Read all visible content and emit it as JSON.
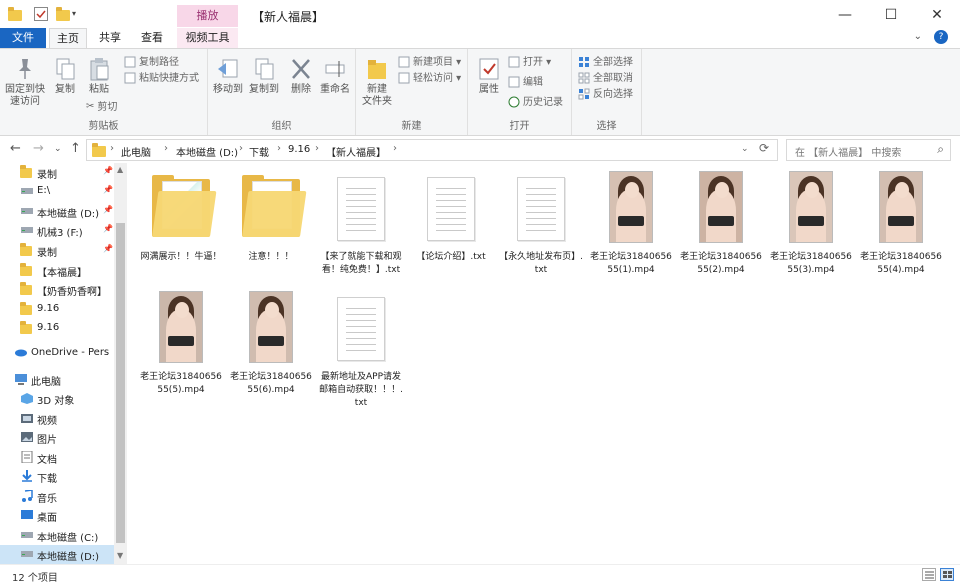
{
  "titlebar": {
    "context_tab_header": "播放",
    "title": "【新人福晨】",
    "minimize": "—",
    "maximize": "☐",
    "close": "✕"
  },
  "tabs": [
    {
      "label": "文件"
    },
    {
      "label": "主页"
    },
    {
      "label": "共享"
    },
    {
      "label": "查看"
    },
    {
      "label": "视频工具"
    }
  ],
  "ribbon": {
    "clipboard": {
      "label": "剪贴板",
      "pin_quick": "固定到快\n速访问",
      "copy": "复制",
      "paste": "粘贴",
      "copy_path": "复制路径",
      "paste_shortcut": "粘贴快捷方式",
      "cut": "剪切"
    },
    "organize": {
      "label": "组织",
      "move_to": "移动到",
      "copy_to": "复制到",
      "delete": "删除",
      "rename": "重命名"
    },
    "new": {
      "label": "新建",
      "new_folder": "新建\n文件夹",
      "new_item": "新建项目 ▾",
      "easy_access": "轻松访问 ▾"
    },
    "open": {
      "label": "打开",
      "properties": "属性",
      "open": "打开 ▾",
      "edit": "编辑",
      "history": "历史记录"
    },
    "select": {
      "label": "选择",
      "select_all": "全部选择",
      "select_none": "全部取消",
      "invert": "反向选择"
    }
  },
  "address": {
    "crumbs": [
      "此电脑",
      "本地磁盘 (D:)",
      "下载",
      "9.16",
      "【新人福晨】"
    ],
    "search_placeholder": "在 【新人福晨】 中搜索"
  },
  "sidebar": {
    "items": [
      {
        "label": "录制",
        "icon": "folder-icon",
        "pinned": true
      },
      {
        "label": "E:\\",
        "icon": "drive-icon",
        "pinned": true
      },
      {
        "label": "本地磁盘 (D:)",
        "icon": "drive-icon",
        "pinned": true
      },
      {
        "label": "机械3 (F:)",
        "icon": "drive-icon",
        "pinned": true
      },
      {
        "label": "录制",
        "icon": "folder-icon",
        "pinned": true
      },
      {
        "label": "【本福晨】",
        "icon": "folder-icon",
        "pinned": false
      },
      {
        "label": "【奶香奶香啊】",
        "icon": "folder-icon",
        "pinned": false
      },
      {
        "label": "9.16",
        "icon": "folder-icon",
        "pinned": false
      },
      {
        "label": "9.16",
        "icon": "folder-icon",
        "pinned": false
      },
      {
        "label": "OneDrive - Pers",
        "icon": "cloud-icon",
        "pinned": false
      },
      {
        "label": "此电脑",
        "icon": "computer-icon",
        "pinned": false
      },
      {
        "label": "3D 对象",
        "icon": "cube-icon",
        "pinned": false
      },
      {
        "label": "视频",
        "icon": "video-icon",
        "pinned": false
      },
      {
        "label": "图片",
        "icon": "picture-icon",
        "pinned": false
      },
      {
        "label": "文档",
        "icon": "document-icon",
        "pinned": false
      },
      {
        "label": "下载",
        "icon": "download-icon",
        "pinned": false
      },
      {
        "label": "音乐",
        "icon": "music-icon",
        "pinned": false
      },
      {
        "label": "桌面",
        "icon": "desktop-icon",
        "pinned": false
      },
      {
        "label": "本地磁盘 (C:)",
        "icon": "drive-icon",
        "pinned": false
      },
      {
        "label": "本地磁盘 (D:)",
        "icon": "drive-icon",
        "pinned": false,
        "selected": true
      }
    ]
  },
  "files": [
    {
      "name": "网满展示！！牛逼！",
      "type": "folder-preview"
    },
    {
      "name": "注意！！！",
      "type": "folder"
    },
    {
      "name": "【来了就能下载和观看！纯免费！】.txt",
      "type": "txt"
    },
    {
      "name": "【论坛介绍】.txt",
      "type": "txt"
    },
    {
      "name": "【永久地址发布页】.txt",
      "type": "txt"
    },
    {
      "name": "老王论坛3184065655(1).mp4",
      "type": "video"
    },
    {
      "name": "老王论坛3184065655(2).mp4",
      "type": "video"
    },
    {
      "name": "老王论坛3184065655(3).mp4",
      "type": "video"
    },
    {
      "name": "老王论坛3184065655(4).mp4",
      "type": "video"
    },
    {
      "name": "老王论坛3184065655(5).mp4",
      "type": "video"
    },
    {
      "name": "老王论坛3184065655(6).mp4",
      "type": "video"
    },
    {
      "name": "最新地址及APP请发邮箱自动获取！！！.txt",
      "type": "txt"
    }
  ],
  "status": {
    "count": "12 个项目"
  },
  "colors": {
    "accent": "#1a66c2",
    "context_tab": "#f8d7e8",
    "selection": "#cce4f7"
  }
}
